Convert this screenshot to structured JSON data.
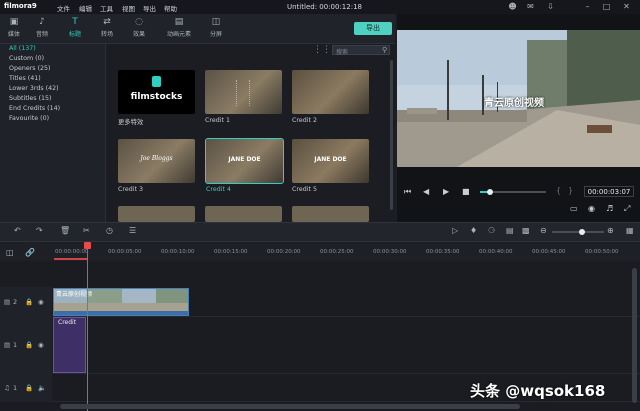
{
  "app": {
    "logo": "filmora9",
    "title": "Untitled:  00:00:12:18"
  },
  "menu": [
    "文件",
    "编辑",
    "工具",
    "视图",
    "导出",
    "帮助"
  ],
  "tools": [
    {
      "label": "媒体",
      "icon": "folder-icon"
    },
    {
      "label": "音频",
      "icon": "music-note-icon"
    },
    {
      "label": "标题",
      "icon": "title-icon",
      "active": true
    },
    {
      "label": "转场",
      "icon": "transition-icon"
    },
    {
      "label": "效果",
      "icon": "effects-icon"
    },
    {
      "label": "动画元素",
      "icon": "elements-icon"
    },
    {
      "label": "分屏",
      "icon": "split-screen-icon"
    }
  ],
  "export_label": "导出",
  "search": {
    "placeholder": "搜索"
  },
  "categories": [
    {
      "label": "All (137)",
      "active": true
    },
    {
      "label": "Custom (0)"
    },
    {
      "label": "Openers (25)"
    },
    {
      "label": "Titles (41)"
    },
    {
      "label": "Lower 3rds (42)"
    },
    {
      "label": "Subtitles (15)"
    },
    {
      "label": "End Credits (14)"
    },
    {
      "label": "Favourite (0)"
    }
  ],
  "thumbnails": [
    {
      "label": "更多特效",
      "text": "filmstocks",
      "type": "promo"
    },
    {
      "label": "Credit 1",
      "text": ""
    },
    {
      "label": "Credit 2",
      "text": ""
    },
    {
      "label": "Credit 3",
      "text": "Joe Bloggs"
    },
    {
      "label": "Credit 4",
      "text": "JANE DOE",
      "selected": true
    },
    {
      "label": "Credit 5",
      "text": "JANE DOE"
    }
  ],
  "preview": {
    "overlay_text": "青云原创视频",
    "timecode": "00:00:03:07",
    "progress": 0.15
  },
  "ruler": [
    "00:00:00:00",
    "00:00:05:00",
    "00:00:10:00",
    "00:00:15:00",
    "00:00:20:00",
    "00:00:25:00",
    "00:00:30:00",
    "00:00:35:00",
    "00:00:40:00",
    "00:00:45:00",
    "00:00:50:00"
  ],
  "tracks": {
    "video2": "2",
    "video1": "1",
    "audio1": "1"
  },
  "clips": {
    "video_label": "青云原创视频",
    "title_label": "Credit"
  },
  "watermark": "头条 @wqsok168",
  "colors": {
    "accent": "#2fd0c2",
    "playhead": "#e84b4b",
    "export": "#4fd1c1"
  }
}
